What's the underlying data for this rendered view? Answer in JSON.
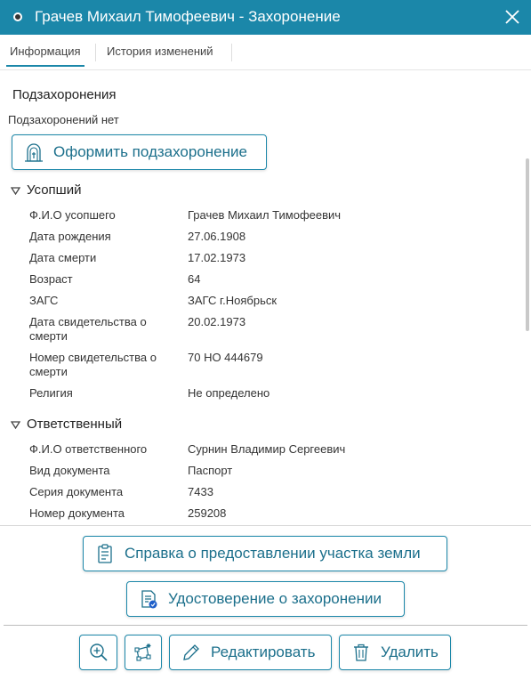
{
  "window": {
    "title": "Грачев Михаил Тимофеевич - Захоронение"
  },
  "tabs": [
    {
      "label": "Информация",
      "active": true
    },
    {
      "label": "История изменений",
      "active": false
    }
  ],
  "subburials": {
    "heading": "Подзахоронения",
    "empty_text": "Подзахоронений нет",
    "button_label": "Оформить подзахоронение"
  },
  "deceased": {
    "heading": "Усопший",
    "fields": [
      {
        "label": "Ф.И.О усопшего",
        "value": "Грачев Михаил Тимофеевич"
      },
      {
        "label": "Дата рождения",
        "value": "27.06.1908"
      },
      {
        "label": "Дата смерти",
        "value": "17.02.1973"
      },
      {
        "label": "Возраст",
        "value": "64"
      },
      {
        "label": "ЗАГС",
        "value": "ЗАГС г.Ноябрьск"
      },
      {
        "label": "Дата свидетельства о смерти",
        "value": "20.02.1973"
      },
      {
        "label": "Номер свидетельства о смерти",
        "value": "70 НО 444679"
      },
      {
        "label": "Религия",
        "value": "Не определено"
      }
    ]
  },
  "responsible": {
    "heading": "Ответственный",
    "fields": [
      {
        "label": "Ф.И.О ответственного",
        "value": "Сурнин Владимир Сергеевич"
      },
      {
        "label": "Вид документа",
        "value": "Паспорт"
      },
      {
        "label": "Серия документа",
        "value": "7433"
      },
      {
        "label": "Номер документа",
        "value": "259208"
      }
    ]
  },
  "actions": {
    "land_certificate_label": "Справка о предоставлении участка земли",
    "burial_certificate_label": "Удостоверение о захоронении",
    "edit_label": "Редактировать",
    "delete_label": "Удалить"
  },
  "colors": {
    "header_bg": "#1b87a9",
    "accent": "#1b87a9",
    "button_text": "#1b6f8b"
  },
  "icons": {
    "close": "close-icon",
    "subburial": "tombstone-icon",
    "section_toggle": "triangle-down-icon",
    "land_certificate": "document-list-icon",
    "burial_certificate": "document-badge-icon",
    "zoom": "zoom-in-icon",
    "locate": "locate-shape-icon",
    "edit": "pencil-icon",
    "delete": "trash-icon"
  }
}
